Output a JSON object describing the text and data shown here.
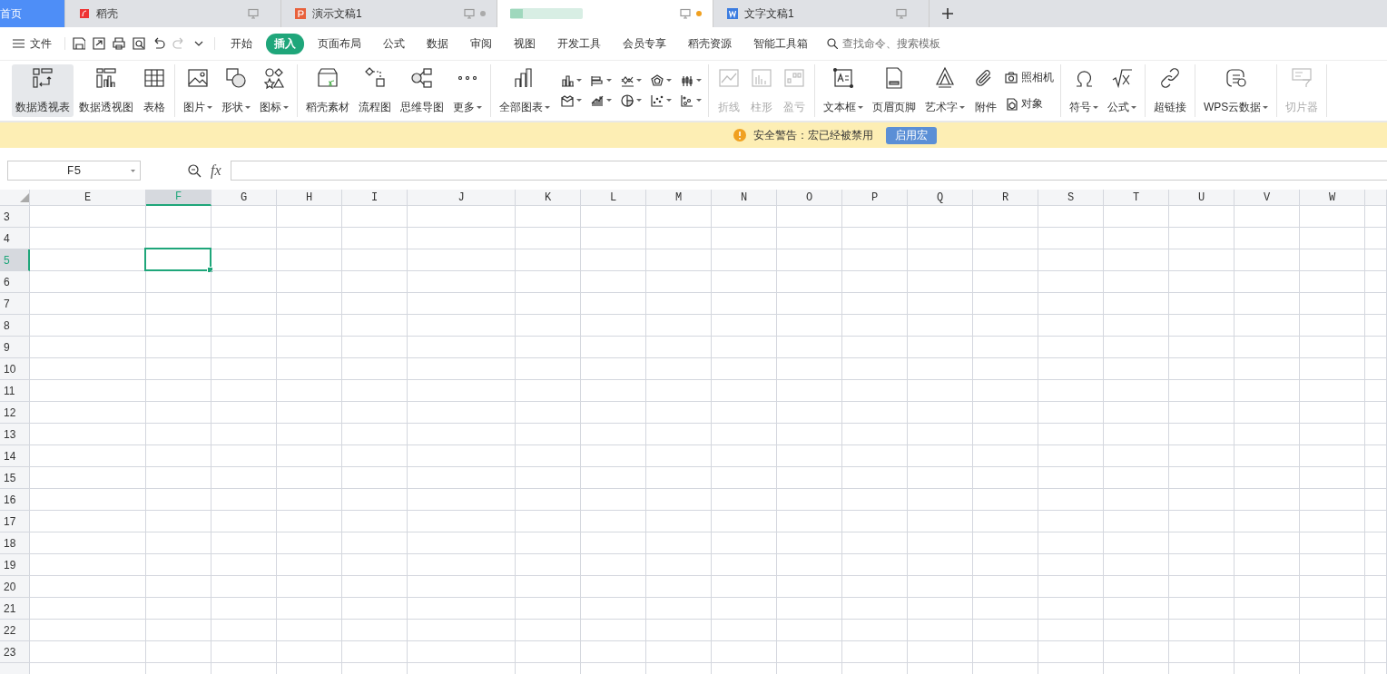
{
  "tabs": [
    {
      "kind": "home",
      "label": "首页",
      "selected": false,
      "dot": false
    },
    {
      "kind": "docer",
      "label": "稻壳",
      "selected": false,
      "dot": false
    },
    {
      "kind": "presentation",
      "label": "演示文稿1",
      "selected": false,
      "dot": true
    },
    {
      "kind": "blurred",
      "selected": true,
      "dot": true
    },
    {
      "kind": "writer",
      "label": "文字文稿1",
      "selected": false,
      "dot": false
    }
  ],
  "menu": {
    "file": "文件",
    "items": [
      {
        "label": "开始",
        "selected": false
      },
      {
        "label": "插入",
        "selected": true
      },
      {
        "label": "页面布局",
        "selected": false
      },
      {
        "label": "公式",
        "selected": false
      },
      {
        "label": "数据",
        "selected": false
      },
      {
        "label": "审阅",
        "selected": false
      },
      {
        "label": "视图",
        "selected": false
      },
      {
        "label": "开发工具",
        "selected": false
      },
      {
        "label": "会员专享",
        "selected": false
      },
      {
        "label": "稻壳资源",
        "selected": false
      },
      {
        "label": "智能工具箱",
        "selected": false
      }
    ],
    "search": {
      "placeholder": "查找命令、搜索模板"
    }
  },
  "ribbon": [
    [
      {
        "kind": "large",
        "label": "数据透视表",
        "dropdown": false,
        "disabled": false,
        "selected": true
      },
      {
        "kind": "large",
        "label": "数据透视图",
        "dropdown": false,
        "disabled": false,
        "selected": false
      },
      {
        "kind": "large",
        "label": "表格",
        "dropdown": false,
        "disabled": false,
        "selected": false
      }
    ],
    [
      {
        "kind": "large",
        "label": "图片",
        "dropdown": true,
        "disabled": false,
        "selected": false
      },
      {
        "kind": "large",
        "label": "形状",
        "dropdown": true,
        "disabled": false,
        "selected": false
      },
      {
        "kind": "large",
        "label": "图标",
        "dropdown": true,
        "disabled": false,
        "selected": false
      }
    ],
    [
      {
        "kind": "large",
        "label": "稻壳素材",
        "dropdown": false,
        "disabled": false,
        "selected": false
      },
      {
        "kind": "large",
        "label": "流程图",
        "dropdown": false,
        "disabled": false,
        "selected": false
      },
      {
        "kind": "large",
        "label": "思维导图",
        "dropdown": false,
        "disabled": false,
        "selected": false
      },
      {
        "kind": "large",
        "label": "更多",
        "dropdown": true,
        "disabled": false,
        "selected": false
      }
    ],
    [
      {
        "kind": "large",
        "label": "全部图表",
        "dropdown": true,
        "disabled": false,
        "selected": false
      },
      {
        "kind": "chart-grid"
      }
    ],
    [
      {
        "kind": "large",
        "label": "折线",
        "dropdown": false,
        "disabled": true,
        "selected": false
      },
      {
        "kind": "large",
        "label": "柱形",
        "dropdown": false,
        "disabled": true,
        "selected": false
      },
      {
        "kind": "large",
        "label": "盈亏",
        "dropdown": false,
        "disabled": true,
        "selected": false
      }
    ],
    [
      {
        "kind": "large",
        "label": "文本框",
        "dropdown": true,
        "disabled": false,
        "selected": false
      },
      {
        "kind": "large",
        "label": "页眉页脚",
        "dropdown": false,
        "disabled": false,
        "selected": false
      },
      {
        "kind": "large",
        "label": "艺术字",
        "dropdown": true,
        "disabled": false,
        "selected": false
      },
      {
        "kind": "large",
        "label": "附件",
        "dropdown": false,
        "disabled": false,
        "selected": false
      },
      {
        "kind": "stack",
        "items": [
          "照相机",
          "对象"
        ]
      }
    ],
    [
      {
        "kind": "large",
        "label": "符号",
        "dropdown": true,
        "disabled": false,
        "selected": false
      },
      {
        "kind": "large",
        "label": "公式",
        "dropdown": true,
        "disabled": false,
        "selected": false
      }
    ],
    [
      {
        "kind": "large",
        "label": "超链接",
        "dropdown": false,
        "disabled": false,
        "selected": false
      }
    ],
    [
      {
        "kind": "large",
        "label": "WPS云数据",
        "dropdown": true,
        "disabled": false,
        "selected": false
      }
    ],
    [
      {
        "kind": "large",
        "label": "切片器",
        "dropdown": false,
        "disabled": true,
        "selected": false
      }
    ]
  ],
  "warning": {
    "text": "安全警告：宏已经被禁用",
    "button": "启用宏"
  },
  "formula_bar": {
    "name_box": "F5",
    "fx": "fx"
  },
  "sheet": {
    "columns": [
      {
        "label": "E",
        "selected": false
      },
      {
        "label": "F",
        "selected": true
      },
      {
        "label": "G",
        "selected": false
      },
      {
        "label": "H",
        "selected": false
      },
      {
        "label": "I",
        "selected": false
      },
      {
        "label": "J",
        "selected": false
      },
      {
        "label": "K",
        "selected": false
      },
      {
        "label": "L",
        "selected": false
      },
      {
        "label": "M",
        "selected": false
      },
      {
        "label": "N",
        "selected": false
      },
      {
        "label": "O",
        "selected": false
      },
      {
        "label": "P",
        "selected": false
      },
      {
        "label": "Q",
        "selected": false
      },
      {
        "label": "R",
        "selected": false
      },
      {
        "label": "S",
        "selected": false
      },
      {
        "label": "T",
        "selected": false
      },
      {
        "label": "U",
        "selected": false
      },
      {
        "label": "V",
        "selected": false
      },
      {
        "label": "W",
        "selected": false
      }
    ],
    "rows": [
      {
        "label": "3",
        "selected": false
      },
      {
        "label": "4",
        "selected": false
      },
      {
        "label": "5",
        "selected": true
      },
      {
        "label": "6",
        "selected": false
      },
      {
        "label": "7",
        "selected": false
      },
      {
        "label": "8",
        "selected": false
      },
      {
        "label": "9",
        "selected": false
      },
      {
        "label": "10",
        "selected": false
      },
      {
        "label": "11",
        "selected": false
      },
      {
        "label": "12",
        "selected": false
      },
      {
        "label": "13",
        "selected": false
      },
      {
        "label": "14",
        "selected": false
      },
      {
        "label": "15",
        "selected": false
      },
      {
        "label": "16",
        "selected": false
      },
      {
        "label": "17",
        "selected": false
      },
      {
        "label": "18",
        "selected": false
      },
      {
        "label": "19",
        "selected": false
      },
      {
        "label": "20",
        "selected": false
      },
      {
        "label": "21",
        "selected": false
      },
      {
        "label": "22",
        "selected": false
      },
      {
        "label": "23",
        "selected": false
      }
    ]
  }
}
